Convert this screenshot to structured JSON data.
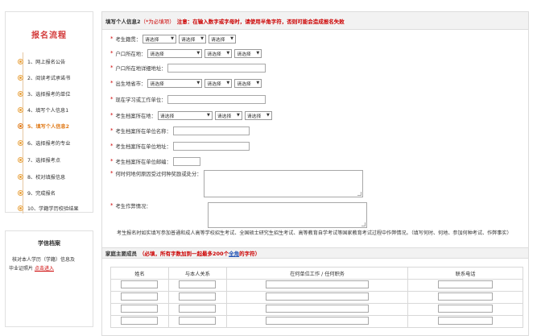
{
  "sidebar": {
    "title": "报名流程",
    "steps": [
      {
        "label": "1、网上报名公告",
        "active": false
      },
      {
        "label": "2、阅读考试承诺书",
        "active": false
      },
      {
        "label": "3、选择报考的单位",
        "active": false
      },
      {
        "label": "4、填写个人信息1",
        "active": false
      },
      {
        "label": "5、填写个人信息2",
        "active": true
      },
      {
        "label": "6、选择报考的专业",
        "active": false
      },
      {
        "label": "7、选择报考点",
        "active": false
      },
      {
        "label": "8、校对填报信息",
        "active": false
      },
      {
        "label": "9、完成报名",
        "active": false
      },
      {
        "label": "10、学籍学历校验结果",
        "active": false
      }
    ],
    "archive": {
      "title": "学信档案",
      "text_line1": "核对本人学历（学籍）信息及",
      "text_line2_prefix": "毕业证照片",
      "link": "点击进入"
    }
  },
  "section": {
    "title": "填写个人信息2",
    "required_note": "（*为必填项）",
    "warning": "注意：在输入数字或字母时，请使用半角字符，否则可能会造成报名失败"
  },
  "form": {
    "hukou_label": "考生籍贯：",
    "select_placeholder": "请选择",
    "residence_label": "户口所在地：",
    "residence_detail_label": "户口所在地详细地址：",
    "birthplace_label": "出生地省市：",
    "current_unit_label": "现在学习或工作单位：",
    "archive_location_label": "考生档案所在地：",
    "archive_unit_name_label": "考生档案所在单位名称：",
    "archive_unit_address_label": "考生档案所在单位地址：",
    "archive_unit_postcode_label": "考生档案所在单位邮编：",
    "punishment_label": "何时何地何原因受过何种奖励或处分：",
    "cheating_label": "考生作弊情况：",
    "note": "考生报名时如实填写参加普通和成人高等学校招生考试、全国硕士研究生招生考试、高等教育自学考试等国家教育考试过程中作弊情况。（填写何时、何地、参加何种考试、作弊事实）"
  },
  "family": {
    "title": "家庭主要成员",
    "warning_prefix": "（必填，所有字数加到一起最多200个",
    "warning_em": "全角",
    "warning_suffix": "的字符）",
    "columns": [
      "姓名",
      "与本人关系",
      "在何单位工作 / 任何职务",
      "联系电话"
    ]
  }
}
